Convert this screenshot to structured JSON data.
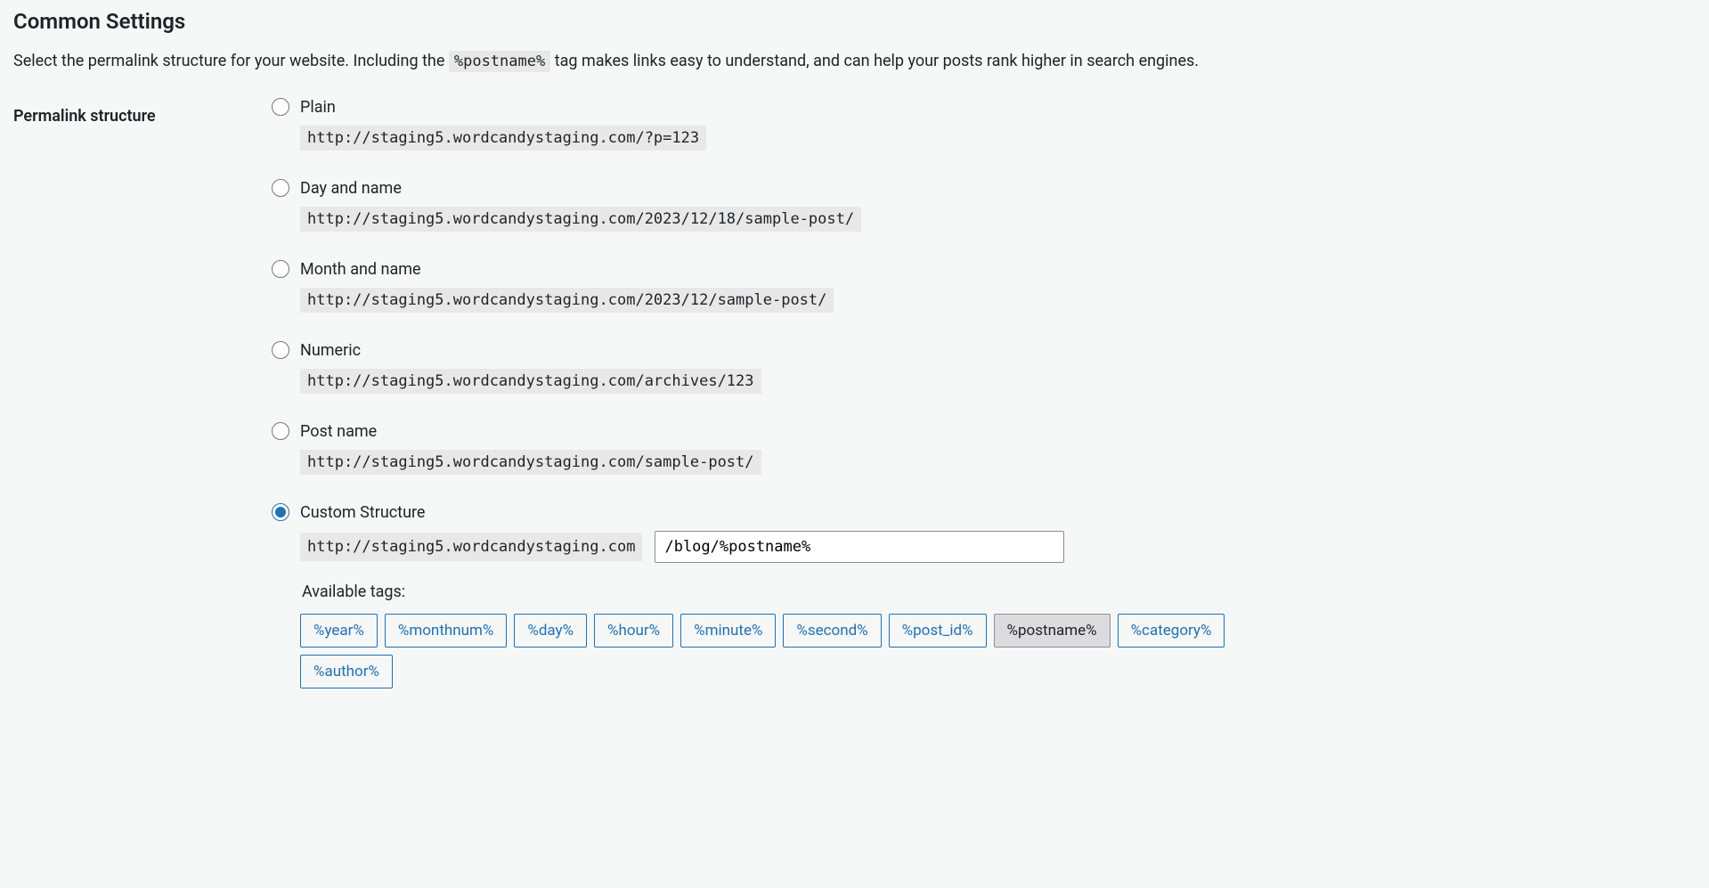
{
  "section": {
    "title": "Common Settings",
    "intro_before": "Select the permalink structure for your website. Including the ",
    "intro_tag": "%postname%",
    "intro_after": " tag makes links easy to understand, and can help your posts rank higher in search engines."
  },
  "form": {
    "field_label": "Permalink structure"
  },
  "options": {
    "plain": {
      "label": "Plain",
      "example": "http://staging5.wordcandystaging.com/?p=123"
    },
    "dayname": {
      "label": "Day and name",
      "example": "http://staging5.wordcandystaging.com/2023/12/18/sample-post/"
    },
    "monthname": {
      "label": "Month and name",
      "example": "http://staging5.wordcandystaging.com/2023/12/sample-post/"
    },
    "numeric": {
      "label": "Numeric",
      "example": "http://staging5.wordcandystaging.com/archives/123"
    },
    "postname": {
      "label": "Post name",
      "example": "http://staging5.wordcandystaging.com/sample-post/"
    },
    "custom": {
      "label": "Custom Structure",
      "prefix": "http://staging5.wordcandystaging.com",
      "value": "/blog/%postname%"
    }
  },
  "tags": {
    "label": "Available tags:",
    "items": {
      "year": "%year%",
      "monthnum": "%monthnum%",
      "day": "%day%",
      "hour": "%hour%",
      "minute": "%minute%",
      "second": "%second%",
      "post_id": "%post_id%",
      "postname": "%postname%",
      "category": "%category%",
      "author": "%author%"
    }
  }
}
